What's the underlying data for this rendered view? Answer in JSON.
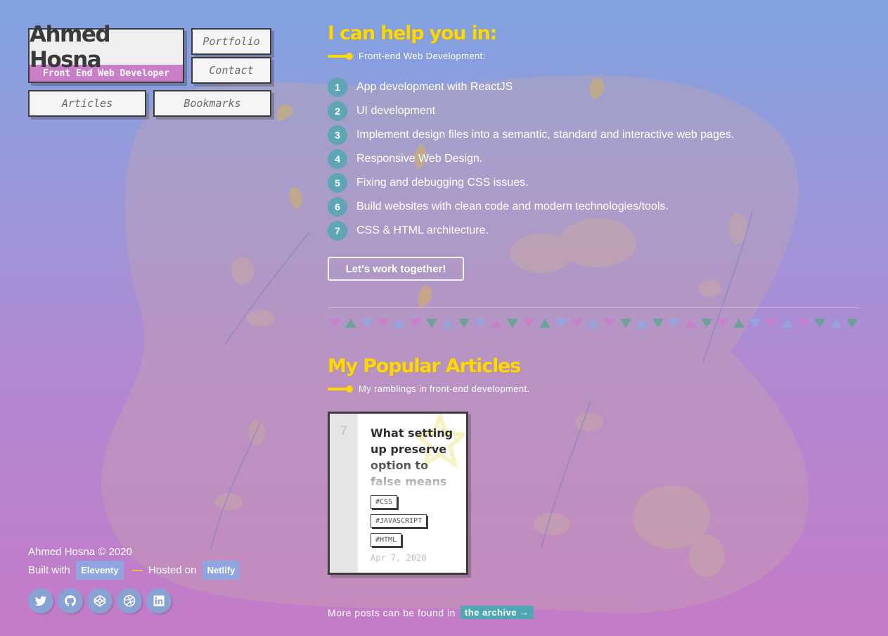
{
  "header": {
    "name": "Ahmed Hosna",
    "role": "Front End Web Developer"
  },
  "nav": {
    "portfolio": "Portfolio",
    "contact": "Contact",
    "articles": "Articles",
    "bookmarks": "Bookmarks"
  },
  "help": {
    "title": "I can help you in:",
    "subtitle": "Front-end Web Development:",
    "items": [
      {
        "num": "1",
        "text": "App development with ReactJS"
      },
      {
        "num": "2",
        "text": "UI development"
      },
      {
        "num": "3",
        "text": "Implement design files into a semantic, standard and interactive web pages."
      },
      {
        "num": "4",
        "text": "Responsive Web Design."
      },
      {
        "num": "5",
        "text": "Fixing and debugging CSS issues."
      },
      {
        "num": "6",
        "text": "Build websites with clean code and modern technologies/tools."
      },
      {
        "num": "7",
        "text": "CSS & HTML architecture."
      }
    ],
    "cta": "Let's work together!"
  },
  "articles": {
    "title": "My Popular Articles",
    "subtitle": "My ramblings in front-end development.",
    "card": {
      "num": "7",
      "title": "What setting up preserve option to false means",
      "tags": [
        "#CSS",
        "#JAVASCRIPT",
        "#HTML"
      ],
      "date": "Apr 7, 2020"
    },
    "more_text": "More posts can be found in",
    "archive_label": "the archive →"
  },
  "footer": {
    "copyright": "Ahmed Hosna © 2020",
    "built_with": "Built with",
    "eleventy": "Eleventy",
    "dash": "—",
    "hosted_on": "Hosted on",
    "netlify": "Netlify"
  },
  "socials": [
    {
      "icon": "twitter-icon"
    },
    {
      "icon": "github-icon"
    },
    {
      "icon": "codepen-icon"
    },
    {
      "icon": "dribbble-icon"
    },
    {
      "icon": "linkedin-icon"
    }
  ],
  "colors": {
    "accent": "#ffd800",
    "teal": "#5ea5b5",
    "pink": "#c97ec8",
    "dark": "#3c3c3c"
  }
}
